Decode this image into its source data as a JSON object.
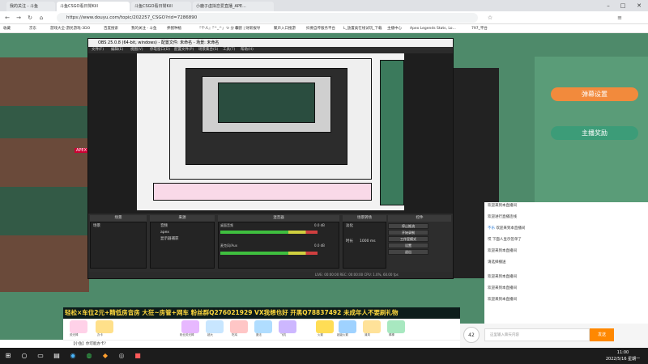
{
  "browser": {
    "tabs": [
      {
        "label": "我的关注 - 斗鱼",
        "active": false
      },
      {
        "label": "斗鱼CSGO看日常Kill",
        "active": true
      },
      {
        "label": "斗鱼CSGO看日常Kill",
        "active": false
      },
      {
        "label": "小鹿子虚拟恋爱直播_APE...",
        "active": false
      }
    ],
    "url": "https://www.douyu.com/topic/202257_CSGO?rid=7286890",
    "bookmarks": [
      "收藏",
      "京东",
      "游戏大全-游民游戏-3DO",
      "百度搜索",
      "我的关注 - 斗鱼",
      "养猪种植",
      "『个人』『^_^』つ 分 ロ",
      "收割 | 财新报导",
      "聚声入口搜游",
      "抖要自传服务平台",
      "L_放置类在线试玩_下载",
      "主播中心",
      "Apex Legends Stats, Lo...",
      "797_平台"
    ]
  },
  "obs": {
    "title": "OBS 25.0.8 (64-bit, windows) - 配置文件: 未命名 - 场景: 未命名",
    "menu": [
      "文件(F)",
      "编辑(E)",
      "视图(V)",
      "停靠窗口(D)",
      "配置文件(P)",
      "场景集合(S)",
      "工具(T)",
      "帮助(H)"
    ],
    "docks": {
      "scenes": {
        "header": "场景",
        "items": [
          "场景"
        ]
      },
      "sources": {
        "header": "来源",
        "items": [
          "音频",
          "apex",
          "显示器捕获"
        ]
      },
      "mixer": {
        "header": "混音器",
        "tracks": [
          {
            "name": "桌面音频",
            "db": "0.0 dB"
          },
          {
            "name": "麦克风/Aux",
            "db": "0.0 dB"
          }
        ]
      },
      "transitions": {
        "header": "场景转场",
        "type": "淡化",
        "duration_label": "时长",
        "duration": "1000 ms"
      },
      "controls": {
        "header": "控件",
        "buttons": [
          "停止推流",
          "开始录制",
          "工作室模式",
          "设置",
          "退出"
        ]
      }
    },
    "status": "LIVE: 00:00:00   REC: 00:00:00   CPU: 1.0%, 60.00 fps"
  },
  "page": {
    "ape_tag": "APEX",
    "fan_buttons": [
      "弹幕设置",
      "主播奖励"
    ],
    "chat_lines": [
      {
        "user": "",
        "text": "欢迎来到本直播间"
      },
      {
        "user": "",
        "text": "欢迎进行直播连线"
      },
      {
        "user": "不乐",
        "text": "欢迎来到本直播间"
      },
      {
        "user": "",
        "text": "哎 下面人显示签单了"
      },
      {
        "user": "",
        "text": "欢迎来到本直播间"
      },
      {
        "user": "",
        "text": "请选择播送"
      },
      {
        "user": "",
        "text": "欢迎来到本直播间"
      },
      {
        "user": "",
        "text": "欢迎来到本直播间"
      },
      {
        "user": "",
        "text": "欢迎来到本直播间"
      }
    ],
    "banner": "轻松×车位2元+精低房音房 大狂~房管+网车 粉丝群Q276021929 VX我想也好 开黑Q78837492 未成年人不要刷礼物",
    "gifts": [
      "荧光棒",
      "办卡",
      "粉丝荧光棒",
      "超大",
      "吃鸡",
      "魔法",
      "飞机",
      "火箭",
      "超级火箭",
      "清风",
      "棒棒"
    ],
    "gift_counts": [
      "42"
    ],
    "bottom_left": "【小鱼】你可能办卡?",
    "chat_placeholder": "这里输入聊天内容",
    "send_label": "发送"
  },
  "taskbar": {
    "time": "11:00",
    "date": "2022/5/16 星期一"
  }
}
